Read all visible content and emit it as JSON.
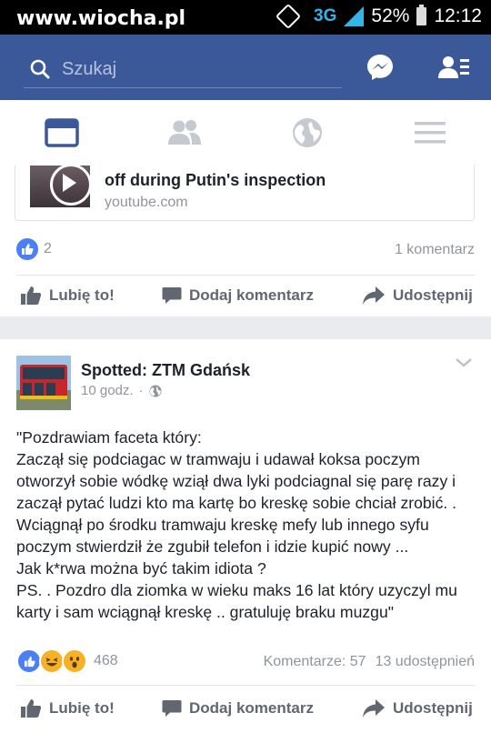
{
  "status_bar": {
    "watermark": "www.wiocha.pl",
    "network": "3G",
    "battery": "52%",
    "time": "12:12"
  },
  "header": {
    "search_placeholder": "Szukaj",
    "brand_color": "#3b5998"
  },
  "tabs": [
    {
      "name": "news-feed",
      "icon": "news-feed-icon",
      "active": true
    },
    {
      "name": "friends",
      "icon": "friends-icon",
      "active": false
    },
    {
      "name": "notifications",
      "icon": "globe-icon",
      "active": false
    },
    {
      "name": "menu",
      "icon": "menu-icon",
      "active": false
    }
  ],
  "post1": {
    "link_title": "off during Putin's inspection",
    "link_domain": "youtube.com",
    "likes": "2",
    "comments": "1 komentarz"
  },
  "actions": {
    "like": "Lubię to!",
    "comment": "Dodaj komentarz",
    "share": "Udostępnij"
  },
  "post2": {
    "page_name": "Spotted: ZTM Gdańsk",
    "time": "10 godz.",
    "separator": "·",
    "text": "\"Pozdrawiam faceta który:\nZaczął się podciagac w tramwaju i udawał koksa poczym otworzył sobie wódkę wziął dwa lyki podciagnal się parę razy i zaczął pytać ludzi kto ma kartę bo kreskę sobie chciał zrobić. .\nWciągnął po środku tramwaju kreskę mefy lub innego syfu poczym stwierdził że zgubił telefon i idzie kupić nowy ...\nJak k*rwa można być takim idiota ?\nPS. . Pozdro dla ziomka w wieku maks 16 lat który uzyczyl mu karty i sam wciągnął kreskę .. gratuluję braku muzgu\"",
    "reactions": "468",
    "comments": "Komentarze: 57",
    "shares": "13 udostępnień"
  }
}
